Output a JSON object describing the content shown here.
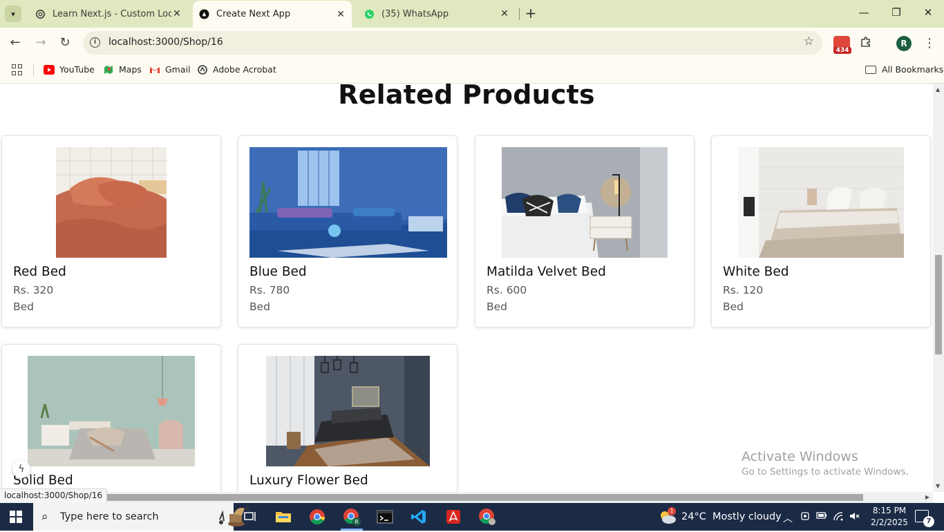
{
  "browser": {
    "tabs": [
      {
        "title": "Learn Next.js - Custom Localhost",
        "favicon": "openai-icon",
        "active": false
      },
      {
        "title": "Create Next App",
        "favicon": "nextjs-icon",
        "active": true
      },
      {
        "title": "(35) WhatsApp",
        "favicon": "whatsapp-icon",
        "active": false
      }
    ],
    "url": "localhost:3000/Shop/16",
    "extension_badge": "434",
    "profile_initial": "R",
    "bookmarks": [
      {
        "label": "YouTube",
        "icon": "youtube-icon",
        "color": "#ff0000"
      },
      {
        "label": "Maps",
        "icon": "maps-icon",
        "color": "#34a853"
      },
      {
        "label": "Gmail",
        "icon": "gmail-icon",
        "color": "#ea4335"
      },
      {
        "label": "Adobe Acrobat",
        "icon": "acrobat-icon",
        "color": "#333333"
      }
    ],
    "all_bookmarks": "All Bookmarks",
    "status_url": "localhost:3000/Shop/16"
  },
  "page": {
    "section_title": "Related Products",
    "products": [
      {
        "name": "Red Bed",
        "price": "Rs. 320",
        "category": "Bed"
      },
      {
        "name": "Blue Bed",
        "price": "Rs. 780",
        "category": "Bed"
      },
      {
        "name": "Matilda Velvet Bed",
        "price": "Rs. 600",
        "category": "Bed"
      },
      {
        "name": "White Bed",
        "price": "Rs. 120",
        "category": "Bed"
      },
      {
        "name": "Solid Bed"
      },
      {
        "name": "Luxury Flower Bed"
      }
    ]
  },
  "watermark": {
    "line1": "Activate Windows",
    "line2": "Go to Settings to activate Windows."
  },
  "taskbar": {
    "search_placeholder": "Type here to search",
    "weather": "24°C  Mostly cloudy",
    "time": "8:15 PM",
    "date": "2/2/2025",
    "notification_count": "7",
    "weather_badge": "1"
  }
}
